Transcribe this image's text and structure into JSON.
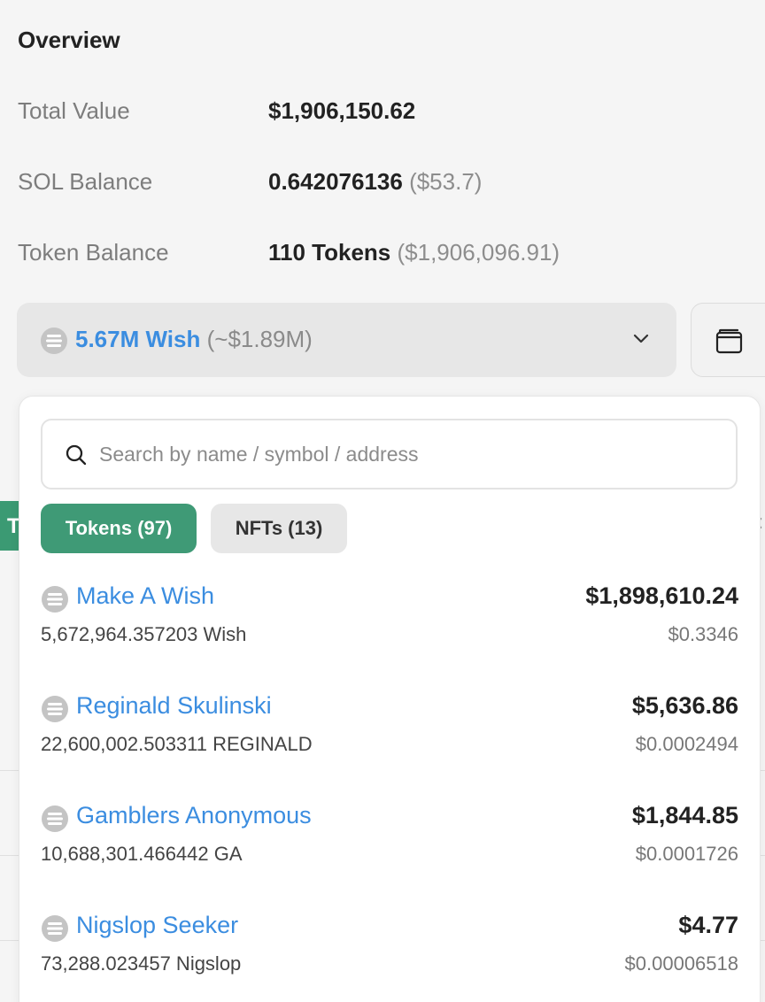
{
  "overview": {
    "title": "Overview",
    "total_value": {
      "label": "Total Value",
      "value": "$1,906,150.62"
    },
    "sol_balance": {
      "label": "SOL Balance",
      "value": "0.642076136",
      "usd": "($53.7)"
    },
    "token_balance": {
      "label": "Token Balance",
      "value": "110 Tokens",
      "usd": "($1,906,096.91)"
    }
  },
  "selector": {
    "amount": "5.67M Wish",
    "usd": "(~$1.89M)",
    "icon": "token-icon",
    "chevron": "chevron-down-icon",
    "wallet_icon": "wallet-icon"
  },
  "dropdown": {
    "search_placeholder": "Search by name / symbol / address",
    "tabs": [
      {
        "label": "Tokens (97)",
        "active": true
      },
      {
        "label": "NFTs (13)",
        "active": false
      }
    ],
    "items": [
      {
        "name": "Make A Wish",
        "balance": "5,672,964.357203 Wish",
        "value": "$1,898,610.24",
        "price": "$0.3346"
      },
      {
        "name": "Reginald Skulinski",
        "balance": "22,600,002.503311 REGINALD",
        "value": "$5,636.86",
        "price": "$0.0002494"
      },
      {
        "name": "Gamblers Anonymous",
        "balance": "10,688,301.466442 GA",
        "value": "$1,844.85",
        "price": "$0.0001726"
      },
      {
        "name": "Nigslop Seeker",
        "balance": "73,288.023457 Nigslop",
        "value": "$4.77",
        "price": "$0.00006518"
      }
    ]
  },
  "colors": {
    "accent_green": "#3f9a76",
    "link_blue": "#3b8de0",
    "muted": "#7d7d7d"
  }
}
